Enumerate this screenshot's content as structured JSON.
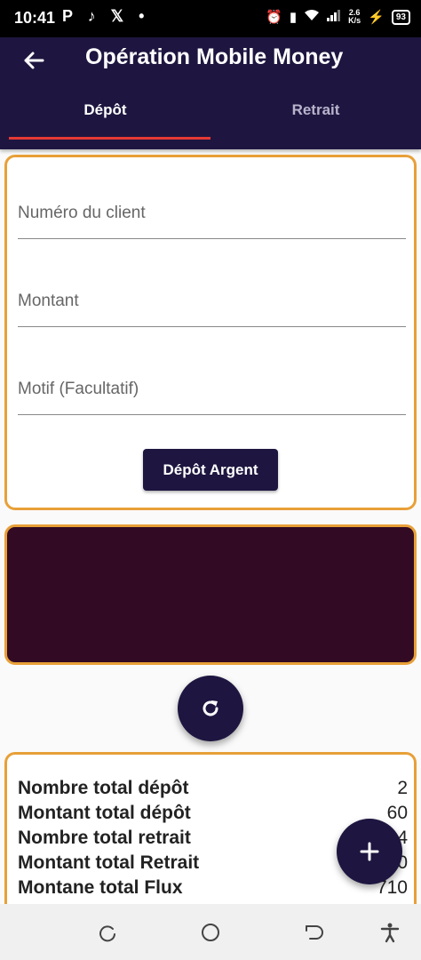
{
  "status_bar": {
    "time": "10:41",
    "left_icons": "P ♪ 𝕏 •",
    "network_speed_value": "2.6",
    "network_speed_unit": "K/s",
    "battery": "93"
  },
  "app_bar": {
    "title": "Opération Mobile Money",
    "tabs": [
      {
        "label": "Dépôt",
        "selected": true
      },
      {
        "label": "Retrait",
        "selected": false
      }
    ]
  },
  "form": {
    "client_number_placeholder": "Numéro du client",
    "amount_placeholder": "Montant",
    "reason_placeholder": "Motif (Facultatif)",
    "submit_label": "Dépôt Argent"
  },
  "stats": [
    {
      "label": "Nombre total dépôt",
      "value": "2"
    },
    {
      "label": "Montant total dépôt",
      "value": "60"
    },
    {
      "label": "Nombre total retrait",
      "value": "4"
    },
    {
      "label": "Montant total Retrait",
      "value": "0"
    },
    {
      "label": "Montane total Flux",
      "value": "710"
    }
  ],
  "colors": {
    "primary": "#1e1640",
    "accent_border": "#e8a038",
    "tab_indicator": "#e53935",
    "dark_panel": "#320a24"
  },
  "icons": {
    "back": "arrow-left-icon",
    "refresh": "refresh-icon",
    "add": "plus-icon"
  }
}
